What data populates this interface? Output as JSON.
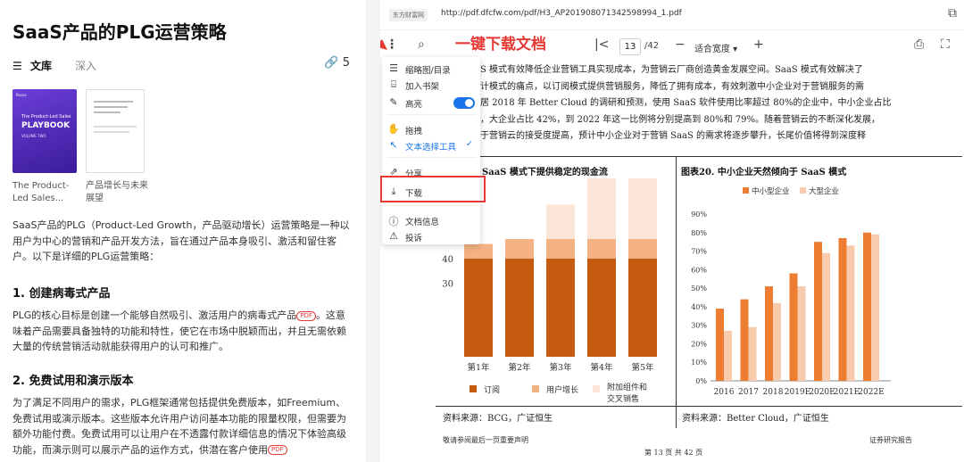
{
  "article": {
    "title": "SaaS产品的PLG运营策略",
    "library_label": "文库",
    "deep_label": "深入",
    "link_count": "5",
    "thumbs": [
      {
        "caption": "The Product-Led Sales...",
        "cover_brand": "Pocus",
        "cover_line1": "The Product-Led Sales",
        "cover_line2": "PLAYBOOK",
        "cover_line3": "VOLUME TWO"
      },
      {
        "caption": "产品增长与未来展望"
      }
    ],
    "intro": "SaaS产品的PLG（Product-Led Growth，产品驱动增长）运营策略是一种以用户为中心的营销和产品开发方法，旨在通过产品本身吸引、激活和留住客户。以下是详细的PLG运营策略：",
    "h1": "1. 创建病毒式产品",
    "p1": "PLG的核心目标是创建一个能够自然吸引、激活用户的病毒式产品",
    "p1_rest": "。这意味着产品需要具备独特的功能和特性，使它在市场中脱颖而出，并且无需依赖大量的传统营销活动就能获得用户的认可和推广。",
    "h2": "2. 免费试用和演示版本",
    "p2": "为了满足不同用户的需求，PLG框架通常包括提供免费版本，如Freemium、免费试用或演示版本。这些版本允许用户访问基本功能的限量权限，但需要为额外功能付费。免费试用可以让用户在不透露付款详细信息的情况下体验高级功能，而演示则可以展示产品的运作方式，供潜在客户使用",
    "pdf_tag": "PDF"
  },
  "viewer": {
    "site_label": "东方财富网",
    "url": "http://pdf.dfcfw.com/pdf/H3_AP201908071342598994_1.pdf",
    "page_current": "13",
    "page_total": "/42",
    "zoom_label": "适合宽度",
    "annotation": "一键下载文档",
    "menu": {
      "items": [
        {
          "icon": "☰",
          "label": "缩略图/目录"
        },
        {
          "icon": "⌸",
          "label": "加入书架"
        },
        {
          "icon": "✎",
          "label": "高亮"
        },
        {
          "icon": "✋",
          "label": "拖拽"
        },
        {
          "icon": "↖",
          "label": "文本选择工具"
        },
        {
          "icon": "⇗",
          "label": "分享"
        },
        {
          "icon": "⤓",
          "label": "下载"
        },
        {
          "icon": "ⓘ",
          "label": "文档信息"
        },
        {
          "icon": "⚠",
          "label": "投诉"
        }
      ],
      "check_mark": "✓"
    },
    "pdf_lines": [
      "S 模式有效降低企业营销工具实现成本，为营销云厂商创造黄金发展空间。SaaS 模式有效解决了",
      "计模式的痛点，以订阅模式提供营销服务，降低了拥有成本，有效刺激中小企业对于营销服务的需",
      "居 2018 年 Better Cloud 的调研和预测，使用 SaaS 软件使用比率超过 80%的企业中，中小企业占比",
      "，大企业占比 42%，到 2022 年这一比例将分别提高到 80%和 79%。随着营销云的不断深化发展，",
      "于营销云的接受度提高，预计中小企业对于营销 SaaS 的需求将逐步攀升，长尾价值将得到深度释"
    ],
    "source_left": "资料来源：BCG，广证恒生",
    "source_right": "资料来源：Better Cloud，广证恒生",
    "footer_left": "敬请参阅最后一页重要声明",
    "footer_center": "第 13 页 共 42 页",
    "footer_right": "证券研究报告"
  },
  "chart_data": [
    {
      "type": "bar",
      "title": "SaaS 模式下提供稳定的现金流",
      "categories": [
        "第1年",
        "第2年",
        "第3年",
        "第4年",
        "第5年"
      ],
      "stacked": true,
      "series": [
        {
          "name": "订阅",
          "color": "#c55a11",
          "values": [
            40,
            40,
            40,
            40,
            40
          ]
        },
        {
          "name": "用户增长",
          "color": "#f4b183",
          "values": [
            6,
            8,
            8,
            8,
            8
          ]
        },
        {
          "name": "附加组件和交叉销售",
          "color": "#fbe5d6",
          "values": [
            0,
            0,
            14,
            28,
            40
          ]
        }
      ],
      "y_tick_labels_visible": [
        "40",
        "30"
      ],
      "legend": "bottom",
      "grid": false
    },
    {
      "type": "bar",
      "title": "图表20. 中小企业天然倾向于 SaaS 模式",
      "categories": [
        "2016",
        "2017",
        "2018",
        "2019E",
        "2020E",
        "2021E",
        "2022E"
      ],
      "series": [
        {
          "name": "中小型企业",
          "color": "#ed7d31",
          "values": [
            39,
            44,
            51,
            58,
            75,
            77,
            80
          ]
        },
        {
          "name": "大型企业",
          "color": "#f8cbad",
          "values": [
            27,
            29,
            42,
            51,
            69,
            73,
            79
          ]
        }
      ],
      "ylim": [
        0,
        90
      ],
      "yticks": [
        "0%",
        "10%",
        "20%",
        "30%",
        "40%",
        "50%",
        "60%",
        "70%",
        "80%",
        "90%"
      ],
      "legend": "top",
      "grid": false
    }
  ]
}
